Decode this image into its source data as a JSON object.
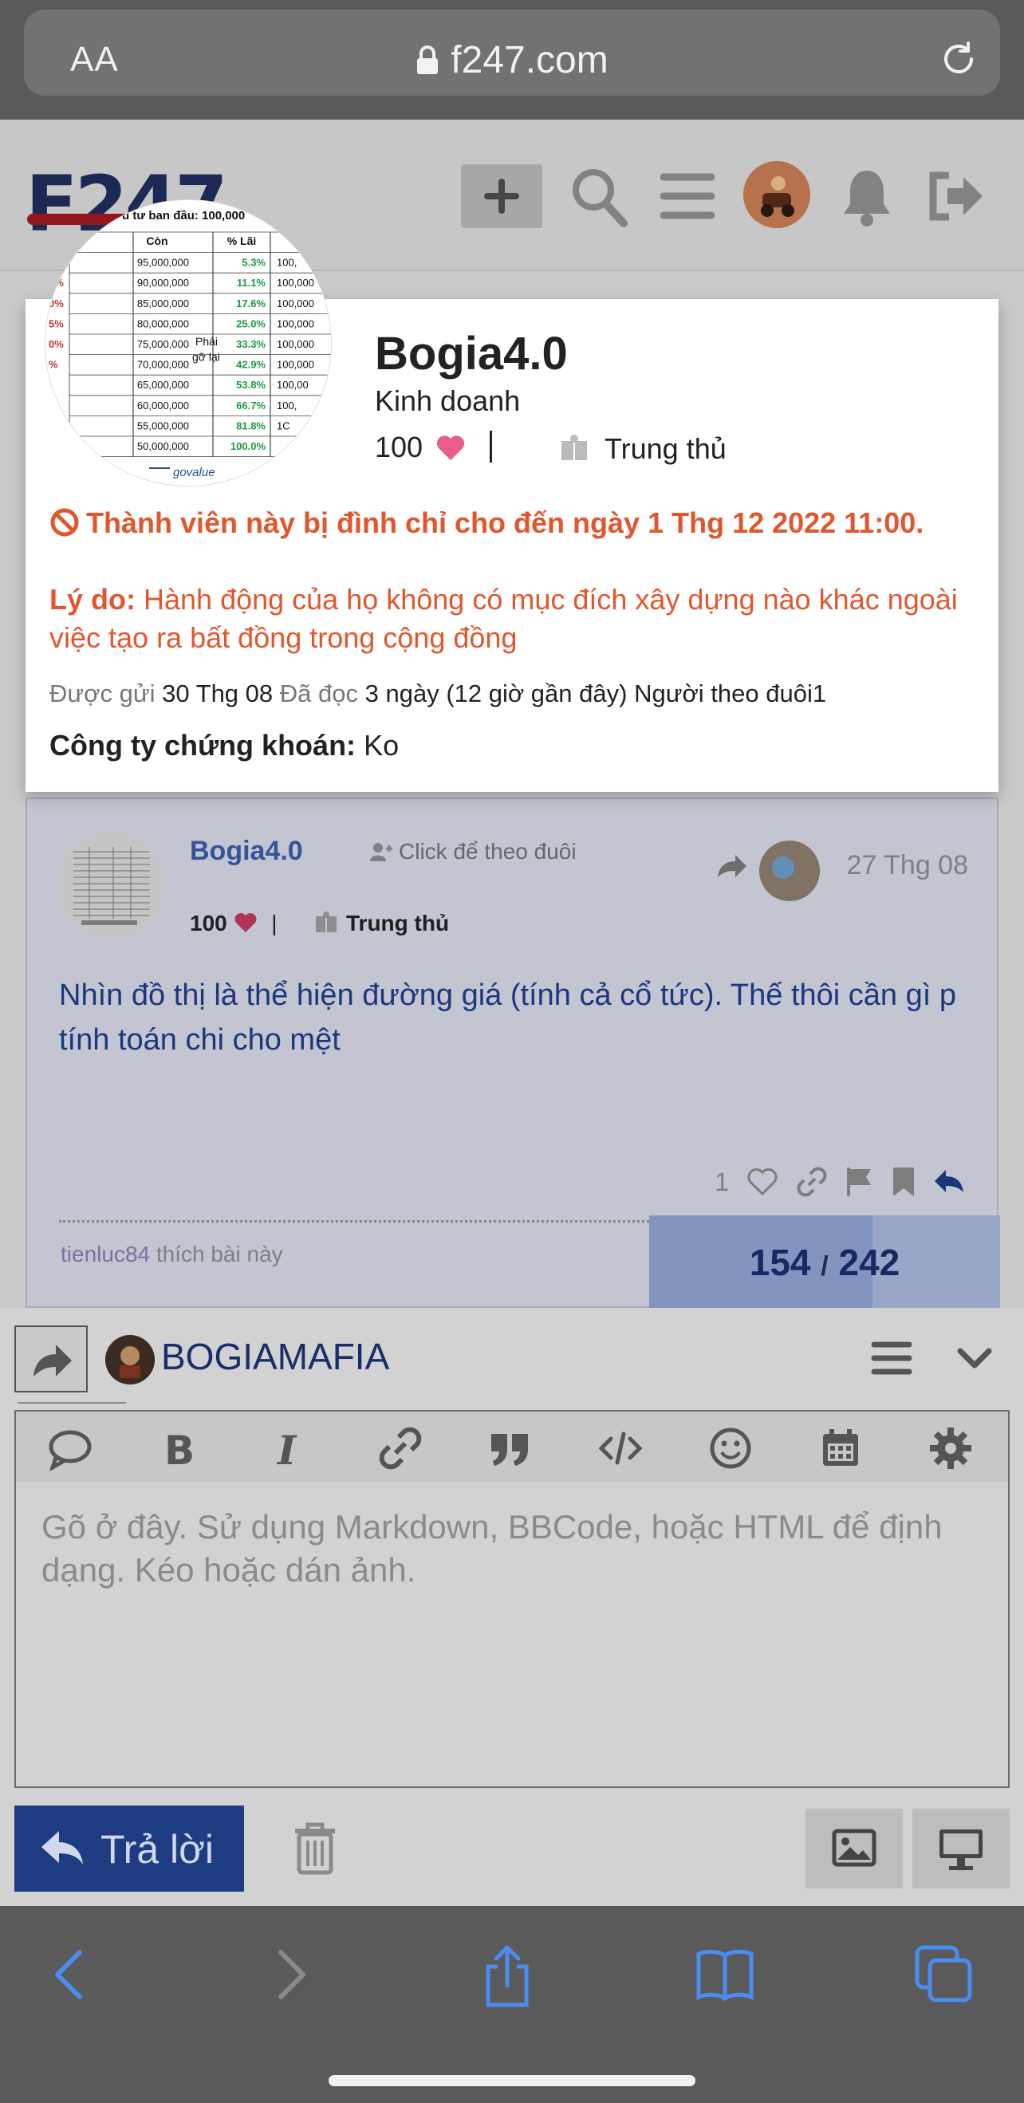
{
  "browser": {
    "text_size_label": "AA",
    "url": "f247.com",
    "icons": [
      "lock-icon",
      "reload-icon",
      "back-icon",
      "forward-icon",
      "share-icon",
      "bookmarks-icon",
      "tabs-icon"
    ]
  },
  "header": {
    "logo_text": "F247",
    "icons": [
      "plus-icon",
      "search-icon",
      "hamburger-icon",
      "avatar",
      "bell-icon",
      "logout-icon"
    ],
    "colors": {
      "logo": "#1f2d5c",
      "logo_bar": "#a11a22"
    }
  },
  "user_card": {
    "name": "Bogia4.0",
    "title": "Kinh doanh",
    "likes": "100",
    "flair": "Trung thủ",
    "suspended_notice": "Thành viên này bị đình chỉ cho đến ngày 1 Thg 12 2022 11:00.",
    "reason_label": "Lý do:",
    "reason_text": "Hành động của họ không có mục đích xây dựng nào khác ngoài việc tạo ra bất đồng trong cộng đồng",
    "posted_label": "Được gửi",
    "posted_value": "30 Thg 08",
    "read_label": "Đã đọc",
    "read_value": "3 ngày (12 giờ gần đây)",
    "followers_label": "Người theo đuôi",
    "followers_value": "1",
    "company_label": "Công ty chứng khoán:",
    "company_value": "Ko",
    "avatar_table": {
      "header_text": "u tư ban đầu: 100,000",
      "col_con": "Còn",
      "col_lai": "% Lãi",
      "con": [
        "95,000,000",
        "90,000,000",
        "85,000,000",
        "80,000,000",
        "75,000,000",
        "70,000,000",
        "65,000,000",
        "60,000,000",
        "55,000,000",
        "50,000,000"
      ],
      "lai": [
        "5.3%",
        "11.1%",
        "17.6%",
        "25.0%",
        "33.3%",
        "42.9%",
        "53.8%",
        "66.7%",
        "81.8%",
        "100.0%"
      ],
      "left_col": [
        "%",
        "5%",
        "0%",
        "5%",
        "0%",
        "%",
        "",
        "",
        "",
        ""
      ],
      "right_col": [
        "100,",
        "100,000",
        "100,000",
        "100,000",
        "100,000",
        "100,000",
        "100,00",
        "100,",
        "1C",
        ""
      ],
      "middle_text": "Phải gỡ lại",
      "brand": "govalue"
    },
    "colors": {
      "suspended": "#e2562d",
      "heart": "#e85d8b"
    }
  },
  "post": {
    "username": "Bogia4.0",
    "follow_text": "Click để theo đuôi",
    "date": "27 Thg 08",
    "likes": "100",
    "flair": "Trung thủ",
    "body": "Nhìn đồ thị là thể hiện đường giá (tính cả cổ tức). Thế thôi cần gì p tính toán chi cho mệt",
    "like_count": "1",
    "liked_by_user": "tienluc84",
    "liked_by_text": "thích bài này",
    "progress_current": "154",
    "progress_sep": "/",
    "progress_total": "242",
    "progress_fraction": 0.636
  },
  "composer": {
    "username": "BOGIAMAFIA",
    "placeholder": "Gõ ở đây. Sử dụng Markdown, BBCode, hoặc HTML để định dạng. Kéo hoặc dán ảnh.",
    "reply_label": "Trả lời",
    "toolbar_icons": [
      "quote-bubble-icon",
      "bold-icon",
      "italic-icon",
      "link-icon",
      "blockquote-icon",
      "code-icon",
      "emoji-icon",
      "calendar-icon",
      "gear-icon"
    ]
  }
}
